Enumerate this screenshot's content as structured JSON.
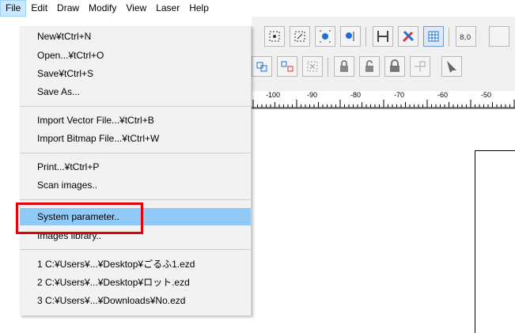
{
  "menubar": {
    "items": [
      {
        "label": "File"
      },
      {
        "label": "Edit"
      },
      {
        "label": "Draw"
      },
      {
        "label": "Modify"
      },
      {
        "label": "View"
      },
      {
        "label": "Laser"
      },
      {
        "label": "Help"
      }
    ]
  },
  "file_menu": {
    "items": [
      {
        "label": "New¥tCtrl+N"
      },
      {
        "label": "Open...¥tCtrl+O"
      },
      {
        "label": "Save¥tCtrl+S"
      },
      {
        "label": "Save As..."
      },
      {
        "label": "Import Vector File...¥tCtrl+B"
      },
      {
        "label": "Import Bitmap File...¥tCtrl+W"
      },
      {
        "label": "Print...¥tCtrl+P"
      },
      {
        "label": "Scan images.."
      },
      {
        "label": "System parameter.."
      },
      {
        "label": "Images library.."
      },
      {
        "label": "1 C:¥Users¥...¥Desktop¥ごるふ1.ezd"
      },
      {
        "label": "2 C:¥Users¥...¥Desktop¥ロット.ezd"
      },
      {
        "label": "3 C:¥Users¥...¥Downloads¥No.ezd"
      }
    ],
    "highlighted": "System parameter..",
    "highlight_color": "#91c9f7",
    "callout_color": "#e3000b"
  },
  "ruler": {
    "labels": [
      "-100",
      "-90",
      "-80",
      "-70",
      "-60",
      "-50"
    ]
  }
}
